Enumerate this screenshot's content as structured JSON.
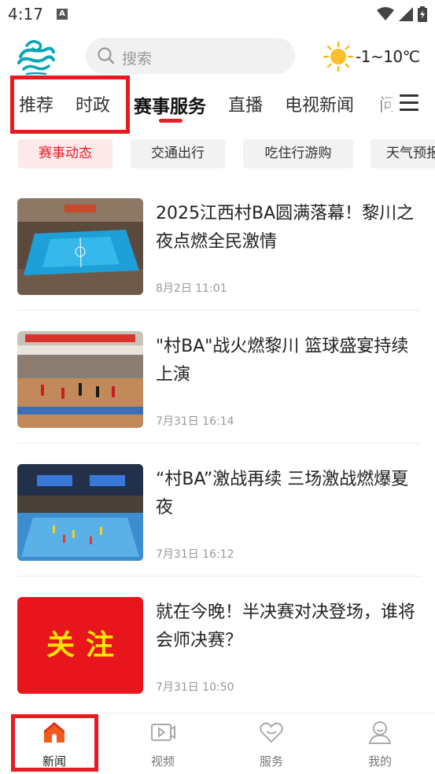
{
  "status_bar": {
    "time": "4:17",
    "notification_letter": "A"
  },
  "header": {
    "search_placeholder": "搜索",
    "weather_text": "-1~10℃"
  },
  "tabs": [
    {
      "label": "推荐"
    },
    {
      "label": "时政"
    },
    {
      "label": "赛事服务"
    },
    {
      "label": "直播"
    },
    {
      "label": "电视新闻"
    },
    {
      "label": "问"
    }
  ],
  "chips": [
    {
      "label": "赛事动态"
    },
    {
      "label": "交通出行"
    },
    {
      "label": "吃住行游购"
    },
    {
      "label": "天气预报"
    }
  ],
  "news": [
    {
      "title": "2025江西村BA圆满落幕！黎川之夜点燃全民激情",
      "time": "8月2日 11:01"
    },
    {
      "title": "\"村BA\"战火燃黎川 篮球盛宴持续上演",
      "time": "7月31日 16:14"
    },
    {
      "title": "“村BA”激战再续 三场激战燃爆夏夜",
      "time": "7月31日 16:12"
    },
    {
      "title": "就在今晚！半决赛对决登场，谁将会师决赛？",
      "time": "7月31日 10:50",
      "thumb_text": "关注"
    }
  ],
  "bottom_nav": [
    {
      "label": "新闻",
      "icon": "home-icon"
    },
    {
      "label": "视频",
      "icon": "video-icon"
    },
    {
      "label": "服务",
      "icon": "heart-icon"
    },
    {
      "label": "我的",
      "icon": "profile-icon"
    }
  ],
  "colors": {
    "accent": "#e5202b",
    "highlight_box": "#e51b22",
    "focus_bg": "#e8151d",
    "focus_text": "#ffe600"
  }
}
